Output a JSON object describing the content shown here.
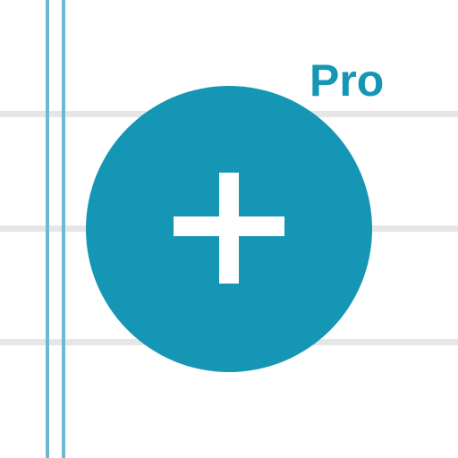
{
  "app_icon": {
    "badge_text": "Pro",
    "accent_color": "#1596b5",
    "margin_line_color": "#6cb9d2",
    "rule_line_color": "#e6e6e6",
    "center_icon": "plus-icon"
  }
}
